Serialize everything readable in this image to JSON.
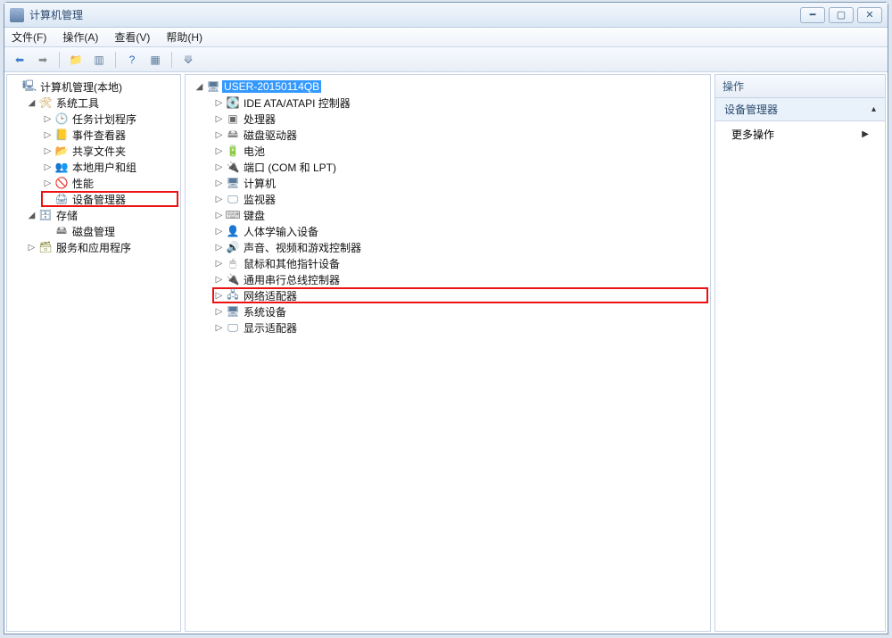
{
  "window": {
    "title": "计算机管理"
  },
  "menu": {
    "file": "文件(F)",
    "action": "操作(A)",
    "view": "查看(V)",
    "help": "帮助(H)"
  },
  "left_tree": {
    "root": "计算机管理(本地)",
    "tools": "系统工具",
    "task_scheduler": "任务计划程序",
    "event_viewer": "事件查看器",
    "shared_folders": "共享文件夹",
    "local_users": "本地用户和组",
    "performance": "性能",
    "device_manager": "设备管理器",
    "storage": "存储",
    "disk_mgmt": "磁盘管理",
    "services_apps": "服务和应用程序"
  },
  "mid_tree": {
    "computer": "USER-20150114QB",
    "ide": "IDE ATA/ATAPI 控制器",
    "cpu": "处理器",
    "disk_drives": "磁盘驱动器",
    "battery": "电池",
    "ports": "端口 (COM 和 LPT)",
    "computers": "计算机",
    "monitors": "监视器",
    "keyboards": "键盘",
    "hid": "人体学输入设备",
    "sound": "声音、视频和游戏控制器",
    "mouse": "鼠标和其他指针设备",
    "usb": "通用串行总线控制器",
    "network": "网络适配器",
    "system_devices": "系统设备",
    "display": "显示适配器"
  },
  "right": {
    "header": "操作",
    "device_manager": "设备管理器",
    "more": "更多操作"
  }
}
